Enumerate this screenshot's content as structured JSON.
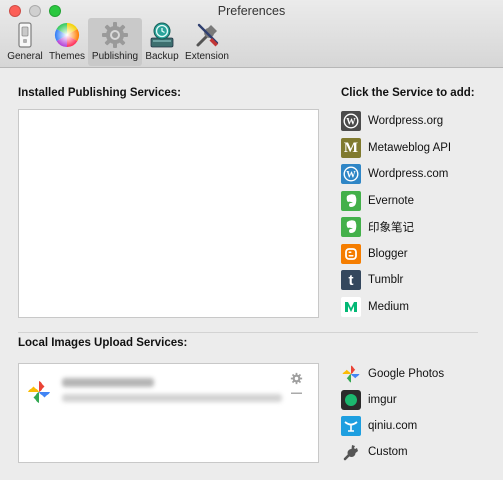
{
  "window": {
    "title": "Preferences"
  },
  "toolbar": {
    "items": [
      {
        "label": "General",
        "icon": "general-switch-icon",
        "active": false
      },
      {
        "label": "Themes",
        "icon": "color-wheel-icon",
        "active": false
      },
      {
        "label": "Publishing",
        "icon": "gear-icon",
        "active": true
      },
      {
        "label": "Backup",
        "icon": "time-machine-icon",
        "active": false
      },
      {
        "label": "Extension",
        "icon": "tools-icon",
        "active": false
      }
    ]
  },
  "publishing": {
    "installed_heading": "Installed Publishing Services:",
    "add_heading": "Click the Service to add:",
    "services": [
      {
        "label": "Wordpress.org",
        "icon": "wordpress-icon",
        "color": "#4b4b4b"
      },
      {
        "label": "Metaweblog API",
        "icon": "metaweblog-icon",
        "color": "#807a2f"
      },
      {
        "label": "Wordpress.com",
        "icon": "wordpress-icon",
        "color": "#2f86c6"
      },
      {
        "label": "Evernote",
        "icon": "evernote-icon",
        "color": "#43b04a"
      },
      {
        "label": "印象笔记",
        "icon": "evernote-icon",
        "color": "#43b04a"
      },
      {
        "label": "Blogger",
        "icon": "blogger-icon",
        "color": "#f57d00"
      },
      {
        "label": "Tumblr",
        "icon": "tumblr-icon",
        "color": "#34475d"
      },
      {
        "label": "Medium",
        "icon": "medium-icon",
        "color": "#ffffff"
      }
    ]
  },
  "images": {
    "heading": "Local Images Upload Services:",
    "services": [
      {
        "label": "Google Photos",
        "icon": "google-photos-icon"
      },
      {
        "label": "imgur",
        "icon": "imgur-icon",
        "color": "#1bb76e"
      },
      {
        "label": "qiniu.com",
        "icon": "qiniu-icon",
        "color": "#1e9fe0"
      },
      {
        "label": "Custom",
        "icon": "wrench-icon"
      }
    ],
    "installed": [
      {
        "service": "Google Photos",
        "remove_label": "—"
      }
    ]
  }
}
